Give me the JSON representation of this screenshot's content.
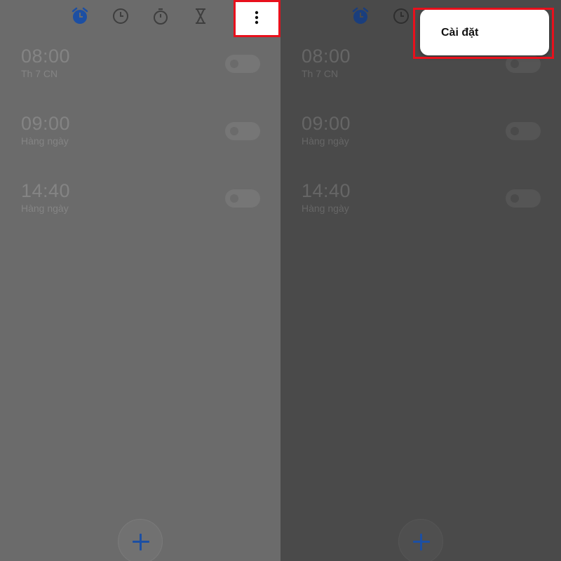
{
  "toolbar": {
    "tabs": [
      {
        "name": "alarm-icon",
        "active": true
      },
      {
        "name": "world-clock-icon",
        "active": false
      },
      {
        "name": "stopwatch-icon",
        "active": false
      },
      {
        "name": "timer-icon",
        "active": false
      }
    ],
    "more": "more-vertical-icon"
  },
  "alarms": [
    {
      "time": "08:00",
      "repeat": "Th 7 CN",
      "enabled": false
    },
    {
      "time": "09:00",
      "repeat": "Hàng ngày",
      "enabled": false
    },
    {
      "time": "14:40",
      "repeat": "Hàng ngày",
      "enabled": false
    }
  ],
  "menu": {
    "items": [
      {
        "label": "Cài đặt"
      }
    ]
  },
  "colors": {
    "accent": "#1c4fa3",
    "highlight": "#e8101c",
    "left_background": "#6b6b6b",
    "right_background": "#4a4a4a"
  }
}
